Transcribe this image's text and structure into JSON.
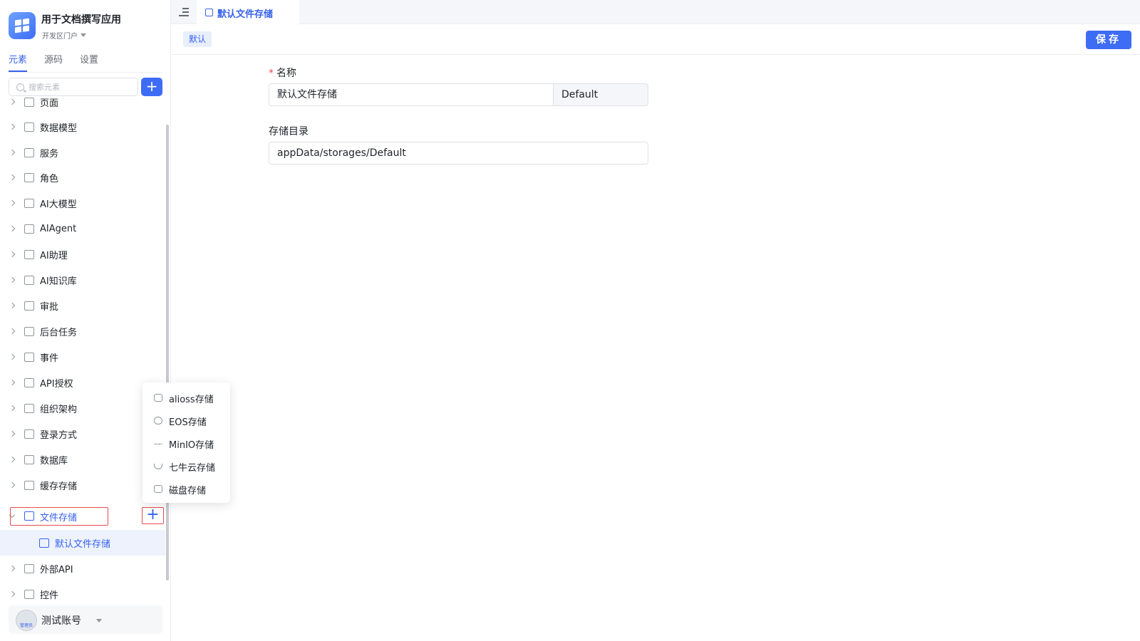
{
  "app": {
    "name": "用于文档撰写应用",
    "portal": "开发区门户"
  },
  "sidebar": {
    "tabs": [
      "元素",
      "源码",
      "设置"
    ],
    "active_tab": "元素",
    "search_placeholder": "搜索元素",
    "add_label": "+",
    "items": [
      {
        "label": "页面",
        "icon": "page-icon"
      },
      {
        "label": "数据模型",
        "icon": "table-icon"
      },
      {
        "label": "服务",
        "icon": "service-icon"
      },
      {
        "label": "角色",
        "icon": "role-icon"
      },
      {
        "label": "AI大模型",
        "icon": "model-icon"
      },
      {
        "label": "AIAgent",
        "icon": "robot-icon"
      },
      {
        "label": "AI助理",
        "icon": "ai-assistant-icon"
      },
      {
        "label": "AI知识库",
        "icon": "book-icon"
      },
      {
        "label": "审批",
        "icon": "stamp-icon"
      },
      {
        "label": "后台任务",
        "icon": "task-icon"
      },
      {
        "label": "事件",
        "icon": "event-icon"
      },
      {
        "label": "API授权",
        "icon": "key-icon"
      },
      {
        "label": "组织架构",
        "icon": "org-icon"
      },
      {
        "label": "登录方式",
        "icon": "building-icon"
      },
      {
        "label": "数据库",
        "icon": "database-icon"
      },
      {
        "label": "缓存存储",
        "icon": "cache-icon"
      },
      {
        "label": "文件存储",
        "icon": "file-storage-icon"
      },
      {
        "label": "默认文件存储",
        "icon": "disk-icon"
      },
      {
        "label": "外部API",
        "icon": "api-icon"
      },
      {
        "label": "控件",
        "icon": "puzzle-icon"
      }
    ]
  },
  "dropdown": {
    "items": [
      {
        "label": "alioss存储",
        "icon": "alioss-icon"
      },
      {
        "label": "EOS存储",
        "icon": "cloud-icon"
      },
      {
        "label": "MinIO存储",
        "icon": "minio-icon"
      },
      {
        "label": "七牛云存储",
        "icon": "qiniu-icon"
      },
      {
        "label": "磁盘存储",
        "icon": "disk-icon"
      }
    ]
  },
  "user": {
    "name": "测试账号",
    "role": "管理员"
  },
  "main": {
    "tab_label": "默认文件存储",
    "tag": "默认",
    "save_label": "保存",
    "form": {
      "name_label": "名称",
      "name_value": "默认文件存储",
      "name_code": "Default",
      "dir_label": "存储目录",
      "dir_value": "appData/storages/Default"
    }
  },
  "colors": {
    "accent": "#3d6cf5",
    "highlight": "#e34d4d"
  }
}
